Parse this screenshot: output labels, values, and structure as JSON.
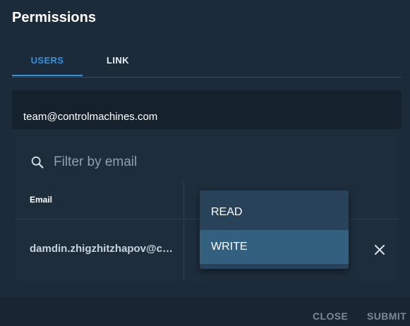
{
  "dialog": {
    "title": "Permissions"
  },
  "tabs": [
    {
      "label": "USERS",
      "active": true
    },
    {
      "label": "LINK",
      "active": false
    }
  ],
  "email_input": {
    "value": "team@controlmachines.com"
  },
  "filter": {
    "placeholder": "Filter by email",
    "icon": "search-icon"
  },
  "table": {
    "columns": [
      "Email"
    ],
    "rows": [
      {
        "email": "damdin.zhigzhitzhapov@controlmachines.com"
      }
    ]
  },
  "menu": {
    "items": [
      "READ",
      "WRITE"
    ],
    "highlighted": "WRITE"
  },
  "footer": {
    "close_label": "CLOSE",
    "submit_label": "SUBMIT"
  },
  "colors": {
    "accent": "#2f93e8",
    "background": "#1b2b3a",
    "menu_background": "#28425a",
    "menu_highlight": "#34607f"
  }
}
